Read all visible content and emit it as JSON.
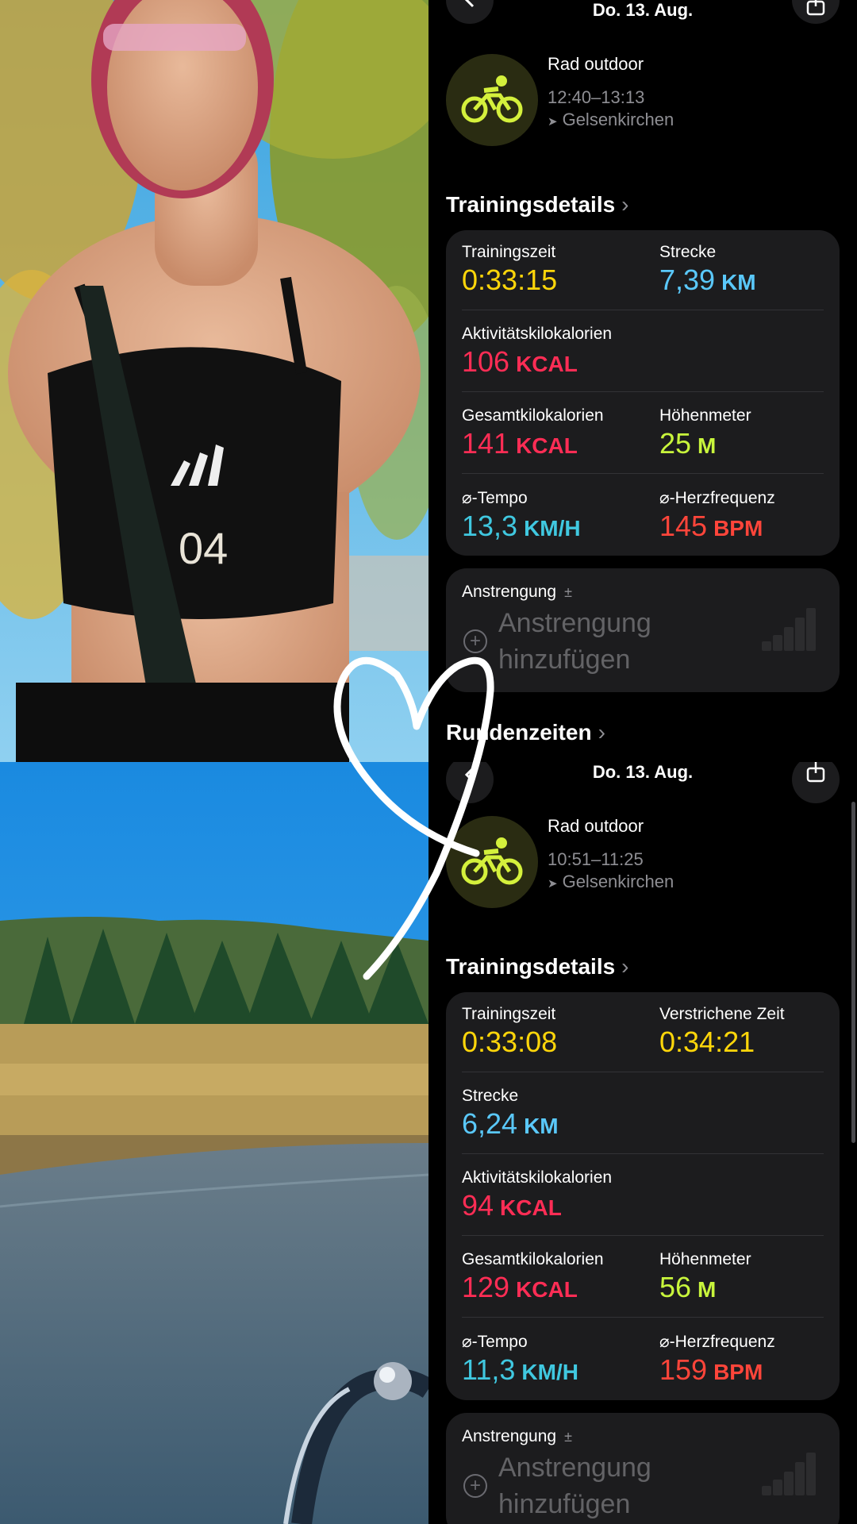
{
  "colors": {
    "yellow": "#ffd60a",
    "blue": "#5ac8fa",
    "red": "#ff2d55",
    "green": "#c8f53c",
    "orange": "#ff453a",
    "cyan": "#40c8e0"
  },
  "icons": {
    "back": "chevron-left",
    "share": "share-box",
    "activity": "bicycle",
    "location": "location-arrow",
    "add": "plus-circle"
  },
  "workout_top": {
    "date": "Do. 13. Aug.",
    "title": "Rad outdoor",
    "time": "12:40–13:13",
    "location": "Gelsenkirchen",
    "section": "Trainingsdetails",
    "training_time_label": "Trainingszeit",
    "training_time": "0:33:15",
    "distance_label": "Strecke",
    "distance": "7,39",
    "distance_unit": "KM",
    "active_kcal_label": "Aktivitätskilokalorien",
    "active_kcal": "106",
    "kcal_unit": "KCAL",
    "total_kcal_label": "Gesamtkilokalorien",
    "total_kcal": "141",
    "elevation_label": "Höhenmeter",
    "elevation": "25",
    "elevation_unit": "M",
    "pace_label": "⌀-Tempo",
    "pace": "13,3",
    "pace_unit": "KM/H",
    "hr_label": "⌀-Herzfrequenz",
    "hr": "145",
    "hr_unit": "BPM",
    "effort_label": "Anstrengung",
    "effort_pm": "±",
    "effort_add_1": "Anstrengung",
    "effort_add_2": "hinzufügen",
    "laps": "Rundenzeiten"
  },
  "workout_bottom": {
    "date": "Do. 13. Aug.",
    "title": "Rad outdoor",
    "time": "10:51–11:25",
    "location": "Gelsenkirchen",
    "section": "Trainingsdetails",
    "training_time_label": "Trainingszeit",
    "training_time": "0:33:08",
    "elapsed_label": "Verstrichene Zeit",
    "elapsed": "0:34:21",
    "distance_label": "Strecke",
    "distance": "6,24",
    "distance_unit": "KM",
    "active_kcal_label": "Aktivitätskilokalorien",
    "active_kcal": "94",
    "kcal_unit": "KCAL",
    "total_kcal_label": "Gesamtkilokalorien",
    "total_kcal": "129",
    "elevation_label": "Höhenmeter",
    "elevation": "56",
    "elevation_unit": "M",
    "pace_label": "⌀-Tempo",
    "pace": "11,3",
    "pace_unit": "KM/H",
    "hr_label": "⌀-Herzfrequenz",
    "hr": "159",
    "hr_unit": "BPM",
    "effort_label": "Anstrengung",
    "effort_pm": "±",
    "effort_add_1": "Anstrengung",
    "effort_add_2": "hinzufügen"
  },
  "photo_top": {
    "shirt_text": "04"
  }
}
